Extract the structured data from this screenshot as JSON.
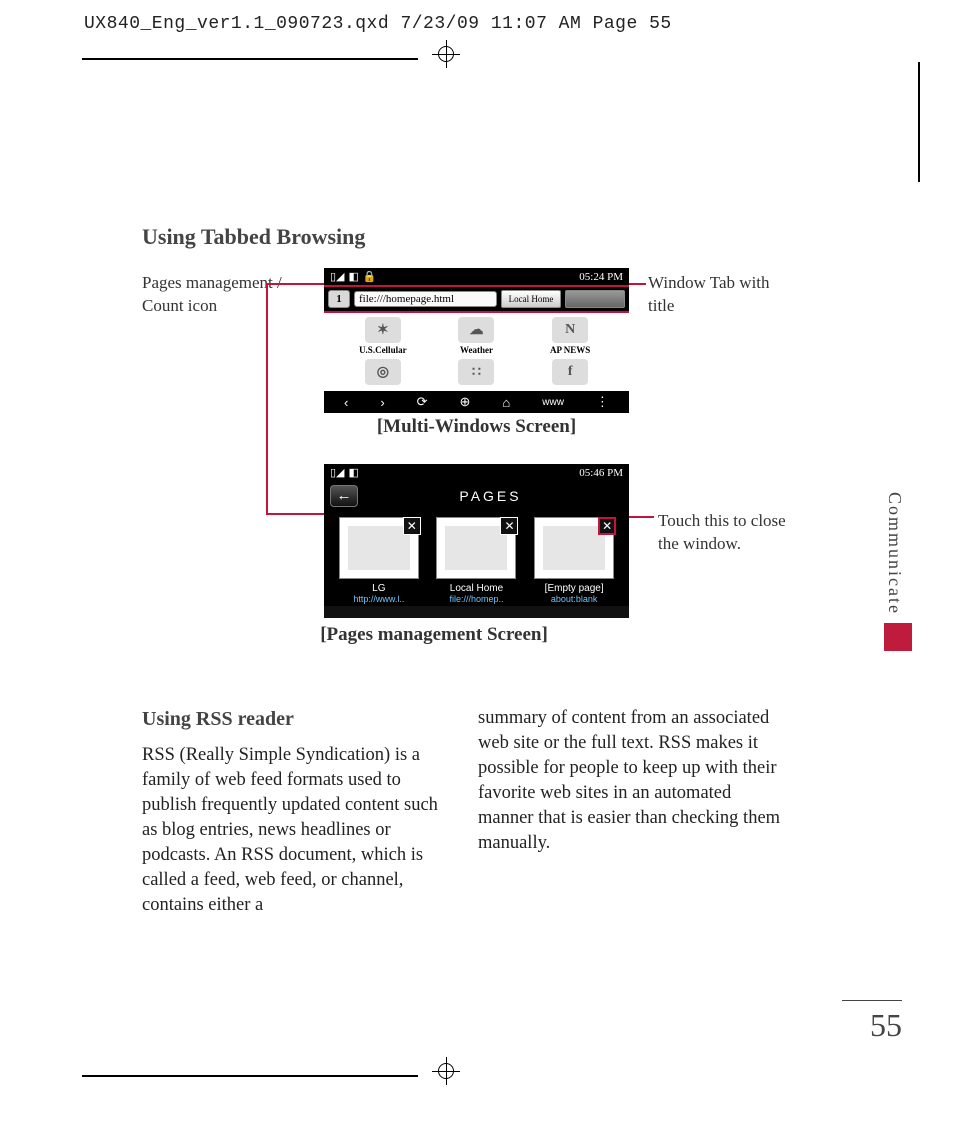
{
  "print_header": "UX840_Eng_ver1.1_090723.qxd  7/23/09  11:07 AM  Page 55",
  "section_heading": "Using Tabbed Browsing",
  "callouts": {
    "pages_mgmt": "Pages management / Count icon",
    "window_tab": "Window Tab with title",
    "close_window": "Touch this to close the window."
  },
  "screenshot1": {
    "time": "05:24 PM",
    "page_count": "1",
    "address": "file:///homepage.html",
    "tab_label": "Local Home",
    "tiles": [
      {
        "label": "U.S.Cellular",
        "icon": "✶"
      },
      {
        "label": "Weather",
        "icon": "☁"
      },
      {
        "label": "AP NEWS",
        "icon": "N"
      },
      {
        "label": "",
        "icon": "◎"
      },
      {
        "label": "",
        "icon": "∷"
      },
      {
        "label": "",
        "icon": "f"
      }
    ],
    "toolbar": [
      "‹",
      "›",
      "⟳",
      "⊕",
      "⌂",
      "www",
      "⋮"
    ]
  },
  "caption1": "[Multi-Windows Screen]",
  "screenshot2": {
    "time": "05:46 PM",
    "back": "←",
    "title": "PAGES",
    "items": [
      {
        "title": "LG",
        "url": "http://www.l.."
      },
      {
        "title": "Local Home",
        "url": "file:///homep.."
      },
      {
        "title": "[Empty page]",
        "url": "about:blank"
      }
    ],
    "close_glyph": "✕"
  },
  "caption2": "[Pages management Screen]",
  "subsection_heading": "Using RSS reader",
  "body_col1": "RSS (Really Simple Syndication) is a family of web feed formats used to publish frequently updated content such as blog entries, news headlines or podcasts. An RSS document, which is called a feed, web feed, or channel, contains either a",
  "body_col2": "summary of content from an associated web site or the full text. RSS makes it possible for people to keep up with their favorite web sites in an automated manner that is easier than checking them manually.",
  "side_tab": "Communicate",
  "page_number": "55"
}
